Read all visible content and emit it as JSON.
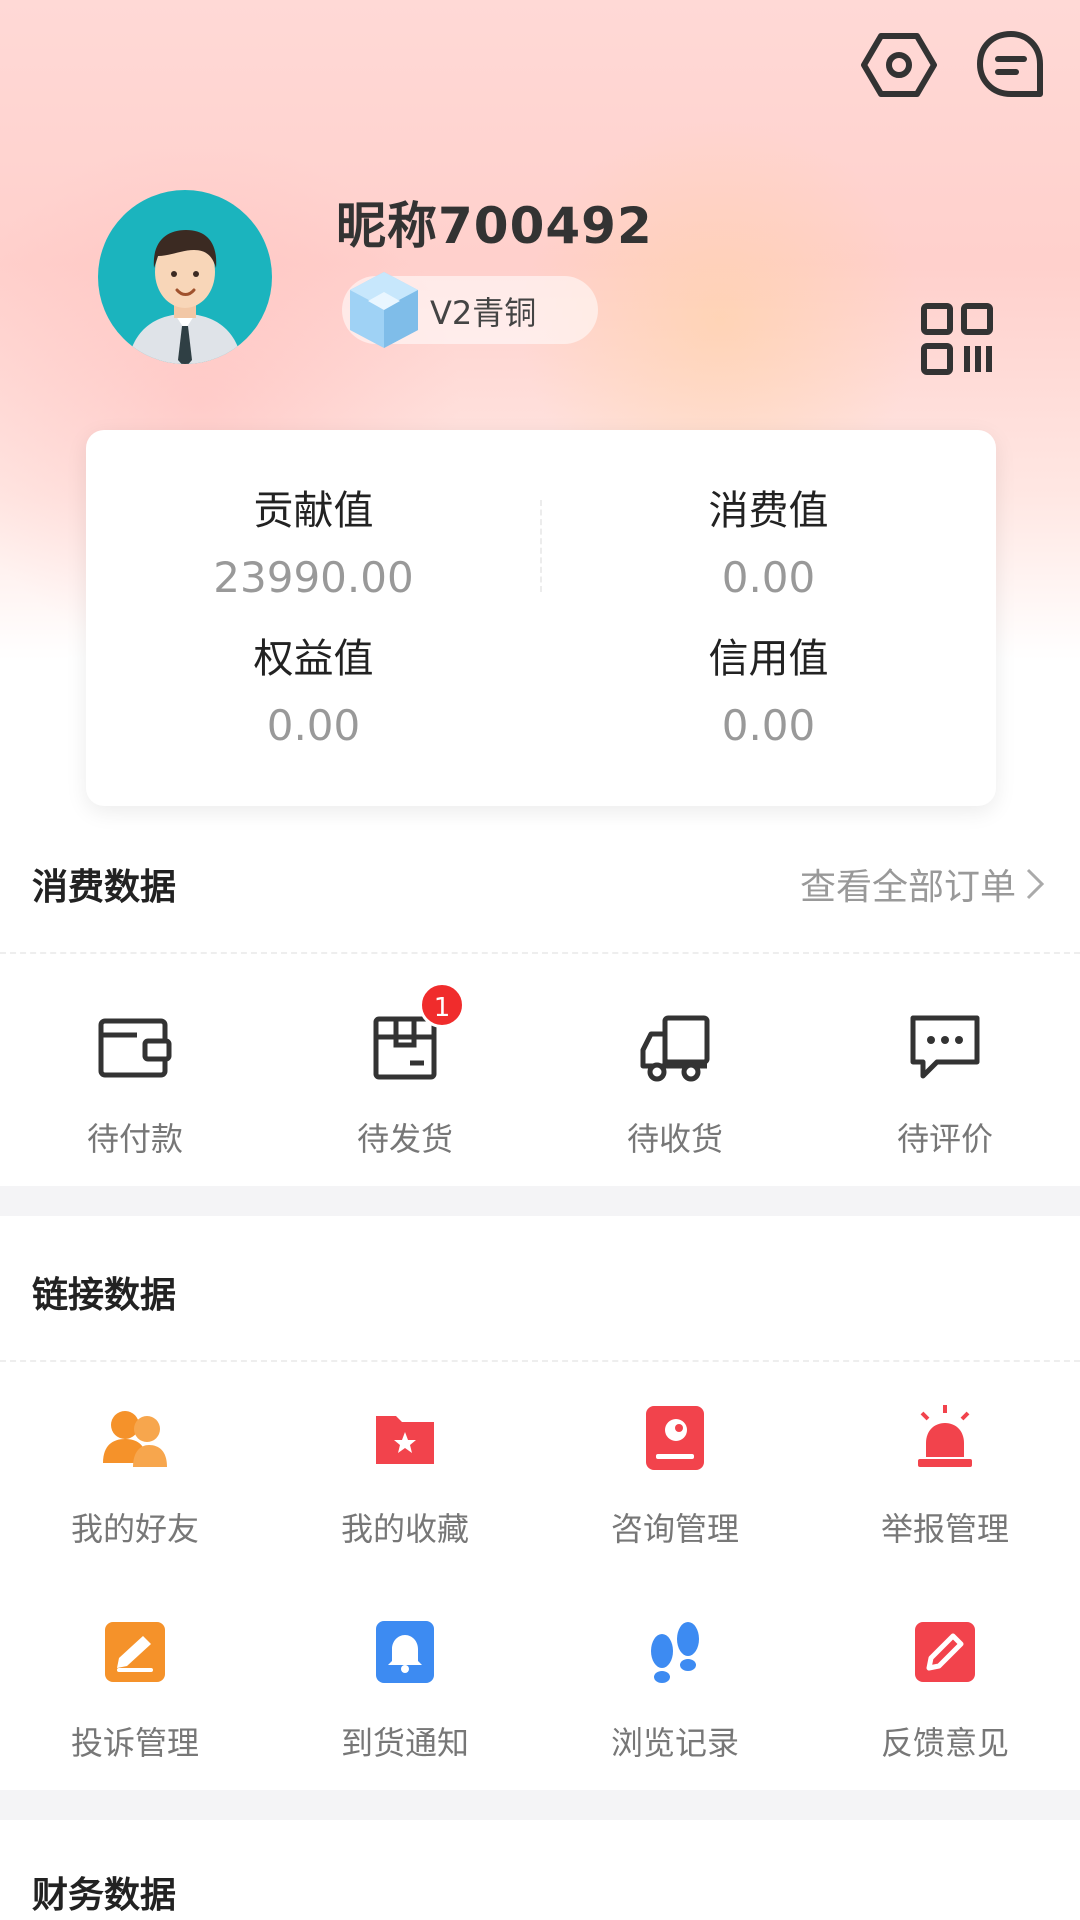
{
  "profile": {
    "nickname": "昵称700492",
    "level_label": "V2青铜"
  },
  "stats": {
    "contribution": {
      "label": "贡献值",
      "value": "23990.00"
    },
    "consumption": {
      "label": "消费值",
      "value": "0.00"
    },
    "equity": {
      "label": "权益值",
      "value": "0.00"
    },
    "credit": {
      "label": "信用值",
      "value": "0.00"
    }
  },
  "consumption_section": {
    "title": "消费数据",
    "view_all": "查看全部订单",
    "items": [
      {
        "label": "待付款",
        "icon": "wallet-icon"
      },
      {
        "label": "待发货",
        "icon": "package-icon",
        "badge": "1"
      },
      {
        "label": "待收货",
        "icon": "delivery-truck-icon"
      },
      {
        "label": "待评价",
        "icon": "comment-icon"
      }
    ]
  },
  "link_section": {
    "title": "链接数据",
    "items": [
      {
        "label": "我的好友",
        "icon": "friends-icon",
        "color": "#f5922a"
      },
      {
        "label": "我的收藏",
        "icon": "favorites-folder-icon",
        "color": "#f2434c"
      },
      {
        "label": "咨询管理",
        "icon": "consult-icon",
        "color": "#f2434c"
      },
      {
        "label": "举报管理",
        "icon": "alarm-icon",
        "color": "#f2434c"
      },
      {
        "label": "投诉管理",
        "icon": "complaint-icon",
        "color": "#f5922a"
      },
      {
        "label": "到货通知",
        "icon": "bell-icon",
        "color": "#3d8bf2"
      },
      {
        "label": "浏览记录",
        "icon": "footprints-icon",
        "color": "#3d8bf2"
      },
      {
        "label": "反馈意见",
        "icon": "feedback-edit-icon",
        "color": "#f2434c"
      }
    ]
  },
  "finance_section": {
    "title": "财务数据"
  }
}
